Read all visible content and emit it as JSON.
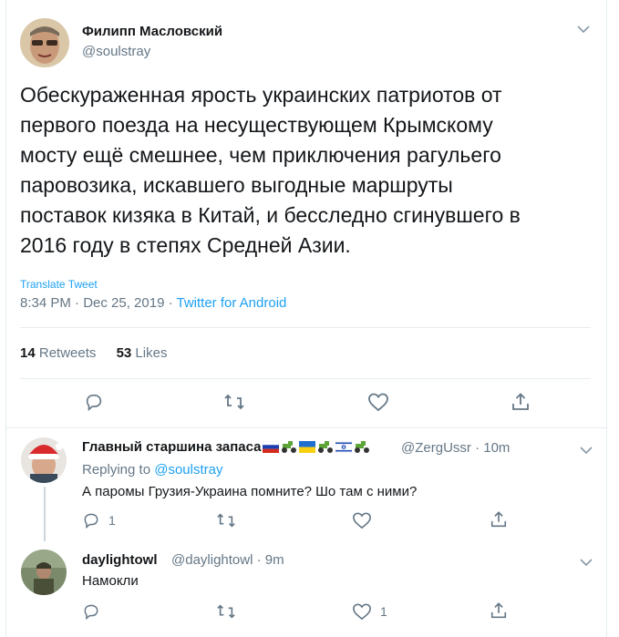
{
  "tweet": {
    "author_name": "Филипп Масловский",
    "author_handle": "@soulstray",
    "text": "Обескураженная ярость украинских патриотов от\nпервого поезда на несуществующем Крымскому\nмосту ещё смешнее, чем приключения рагульего\nпаровозика, искавшего выгодные маршруты\nпоставок кизяка в Китай, и бесследно сгинувшего в\n2016 году в степях Средней Азии.",
    "translate_label": "Translate Tweet",
    "time": "8:34 PM · Dec 25, 2019 · ",
    "source": "Twitter for Android",
    "retweets_count": "14",
    "retweets_label": "Retweets",
    "likes_count": "53",
    "likes_label": "Likes"
  },
  "replies": [
    {
      "author_name": "Главный старшина запаса",
      "author_handle": "@ZergUssr · 10m",
      "replying_prefix": "Replying to ",
      "replying_to": "@soulstray",
      "text": "А паромы Грузия-Украина помните? Шо там с ними?",
      "reply_count": "1",
      "like_count": ""
    },
    {
      "author_name": "daylightowl",
      "author_handle": "@daylightowl · 9m",
      "text": "Намокли",
      "reply_count": "",
      "like_count": "1"
    }
  ],
  "icons": [
    "chevron-down-icon",
    "reply-icon",
    "retweet-icon",
    "like-icon",
    "share-icon"
  ],
  "colors": {
    "accent": "#1da1f2",
    "muted": "#657786",
    "text": "#14171a"
  }
}
